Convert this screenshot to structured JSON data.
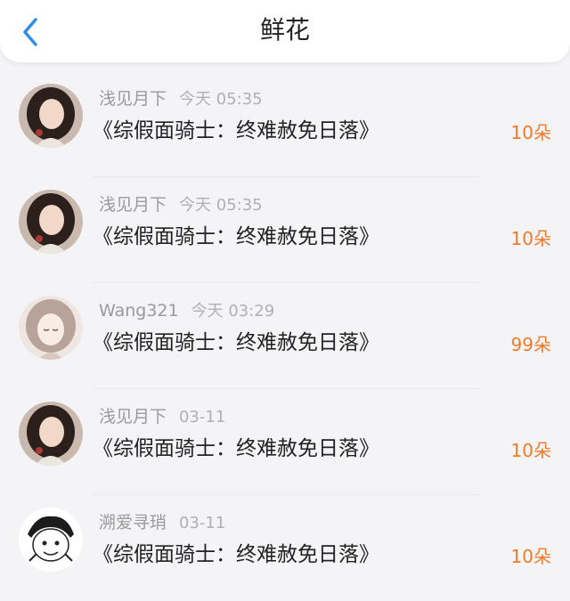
{
  "header": {
    "title": "鲜花",
    "back_icon": "chevron-left-icon"
  },
  "accent_color": "#f07a2c",
  "items": [
    {
      "user": "浅见月下",
      "time": "今天 05:35",
      "book": "《综假面骑士：终难赦免日落》",
      "count": "10朵",
      "avatar": "photo-avatar"
    },
    {
      "user": "浅见月下",
      "time": "今天 05:35",
      "book": "《综假面骑士：终难赦免日落》",
      "count": "10朵",
      "avatar": "photo-avatar"
    },
    {
      "user": "Wang321",
      "time": "今天 03:29",
      "book": "《综假面骑士：终难赦免日落》",
      "count": "99朵",
      "avatar": "anime-avatar"
    },
    {
      "user": "浅见月下",
      "time": "03-11",
      "book": "《综假面骑士：终难赦免日落》",
      "count": "10朵",
      "avatar": "photo-avatar"
    },
    {
      "user": "溯爱寻琑",
      "time": "03-11",
      "book": "《综假面骑士：终难赦免日落》",
      "count": "10朵",
      "avatar": "cartoon-avatar"
    }
  ]
}
